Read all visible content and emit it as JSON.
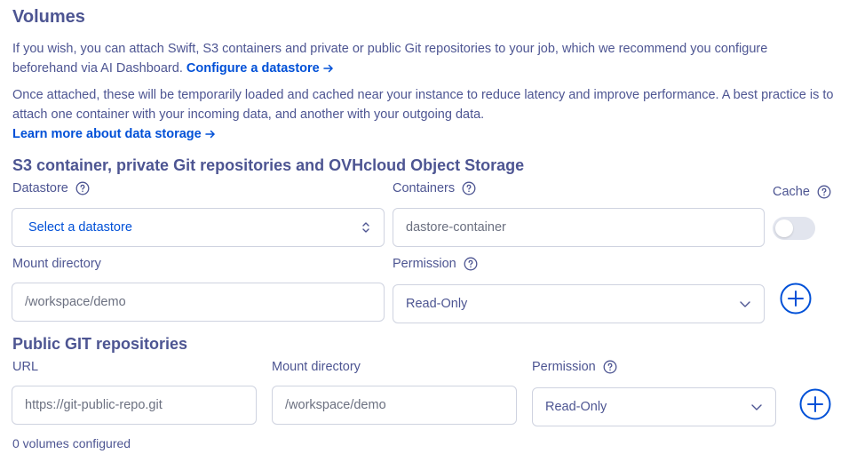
{
  "page": {
    "title": "Volumes",
    "intro": {
      "text1": "If you wish, you can attach Swift, S3 containers and private or public Git repositories to your job, which we recommend you configure",
      "text2": "beforehand via AI Dashboard.",
      "link": "Configure a datastore"
    },
    "desc": {
      "line1": "Once attached, these will be temporarily loaded and cached near your instance to reduce latency and improve performance. A best practice is to",
      "line2": "attach one container with your incoming data, and another with your outgoing data."
    },
    "learn_link": "Learn more about data storage"
  },
  "s3_section": {
    "title": "S3 container, private Git repositories and OVHcloud Object Storage",
    "datastore": {
      "label": "Datastore",
      "value": "Select a datastore"
    },
    "containers": {
      "label": "Containers",
      "placeholder": "dastore-container"
    },
    "cache": {
      "label": "Cache",
      "enabled": false
    },
    "mount": {
      "label": "Mount directory",
      "placeholder": "/workspace/demo"
    },
    "permission": {
      "label": "Permission",
      "value": "Read-Only"
    }
  },
  "git_section": {
    "title": "Public GIT repositories",
    "url": {
      "label": "URL",
      "placeholder": "https://git-public-repo.git"
    },
    "mount": {
      "label": "Mount directory",
      "placeholder": "/workspace/demo"
    },
    "permission": {
      "label": "Permission",
      "value": "Read-Only"
    }
  },
  "footer": {
    "volumes_count": "0 volumes configured"
  },
  "colors": {
    "text": "#4d5592",
    "link": "#0050d7",
    "border": "#cfd3e0",
    "toggle_off": "#e2e5ee"
  }
}
